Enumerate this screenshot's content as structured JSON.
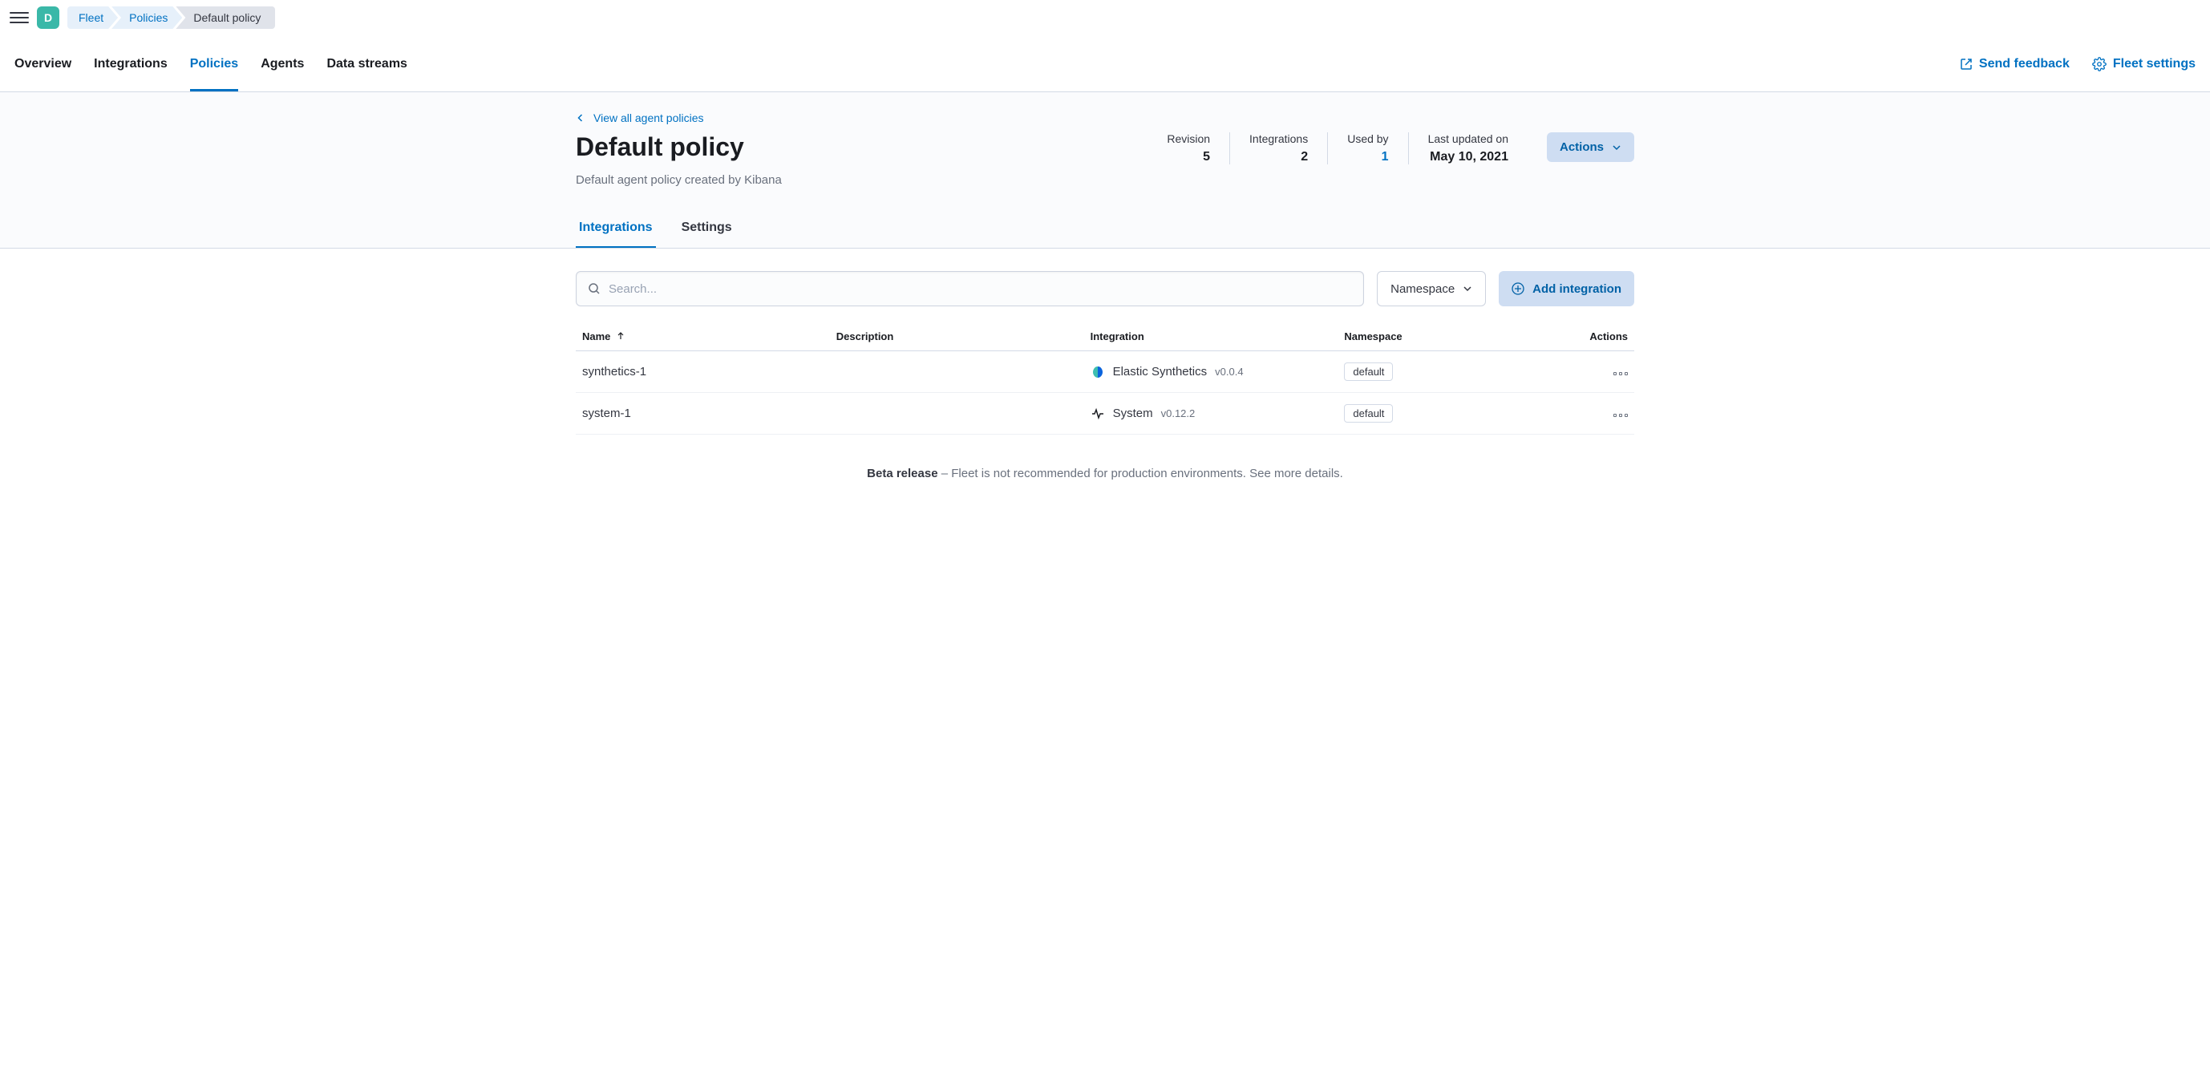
{
  "topbar": {
    "home_letter": "D",
    "breadcrumbs": [
      "Fleet",
      "Policies",
      "Default policy"
    ]
  },
  "nav": {
    "tabs": [
      "Overview",
      "Integrations",
      "Policies",
      "Agents",
      "Data streams"
    ],
    "active_index": 2,
    "feedback_label": "Send feedback",
    "settings_label": "Fleet settings"
  },
  "page": {
    "back_link": "View all agent policies",
    "title": "Default policy",
    "subtitle": "Default agent policy created by Kibana",
    "stats": [
      {
        "label": "Revision",
        "value": "5",
        "link": false
      },
      {
        "label": "Integrations",
        "value": "2",
        "link": false
      },
      {
        "label": "Used by",
        "value": "1",
        "link": true
      },
      {
        "label": "Last updated on",
        "value": "May 10, 2021",
        "link": false
      }
    ],
    "actions_label": "Actions"
  },
  "subtabs": {
    "items": [
      "Integrations",
      "Settings"
    ],
    "active_index": 0
  },
  "controls": {
    "search_placeholder": "Search...",
    "namespace_label": "Namespace",
    "add_label": "Add integration"
  },
  "table": {
    "columns": [
      "Name",
      "Description",
      "Integration",
      "Namespace",
      "Actions"
    ],
    "rows": [
      {
        "name": "synthetics-1",
        "description": "",
        "integration_name": "Elastic Synthetics",
        "integration_version": "v0.0.4",
        "namespace": "default",
        "icon": "synthetics"
      },
      {
        "name": "system-1",
        "description": "",
        "integration_name": "System",
        "integration_version": "v0.12.2",
        "namespace": "default",
        "icon": "system"
      }
    ]
  },
  "footer": {
    "strong": "Beta release",
    "text": " – Fleet is not recommended for production environments. See more details."
  }
}
